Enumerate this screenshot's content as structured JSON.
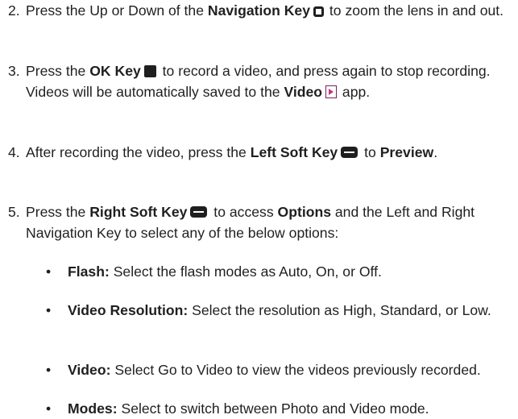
{
  "steps": [
    {
      "number": "2.",
      "parts": [
        "Press the Up or Down of the ",
        "Navigation Key",
        " to zoom the lens in and out."
      ],
      "icon": "navigation-key-icon"
    },
    {
      "number": "3.",
      "parts": [
        "Press the ",
        "OK Key",
        " to record a video, and press again to stop recording. Videos will be automatically saved to the ",
        "Video",
        " app."
      ],
      "icons": [
        "ok-key-icon",
        "video-app-icon"
      ]
    },
    {
      "number": "4.",
      "parts": [
        "After recording the video, press the ",
        "Left Soft Key",
        " to ",
        "Preview",
        "."
      ],
      "icon": "left-soft-key-icon"
    },
    {
      "number": "5.",
      "parts": [
        "Press the ",
        "Right Soft Key",
        " to access ",
        "Options",
        " and the Left and Right Navigation Key to select any of the below options:"
      ],
      "icon": "right-soft-key-icon"
    }
  ],
  "options": [
    {
      "bullet": "•",
      "term": "Flash:",
      "desc": " Select the flash modes as Auto, On, or Off."
    },
    {
      "bullet": "•",
      "term": "Video Resolution:",
      "desc": " Select the resolution as High, Standard, or Low."
    },
    {
      "bullet": "•",
      "term": "Video:",
      "desc": " Select Go to Video to view the videos previously recorded."
    },
    {
      "bullet": "•",
      "term": "Modes:",
      "desc": " Select to switch between Photo and Video mode."
    }
  ]
}
